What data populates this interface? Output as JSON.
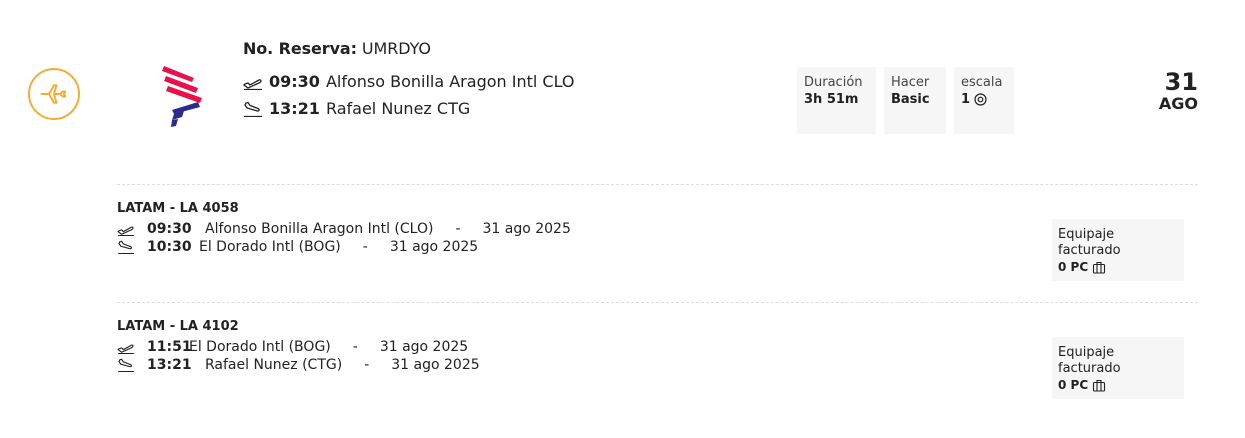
{
  "summary": {
    "booking_label": "No. Reserva:",
    "booking_code": "UMRDYO",
    "departure": {
      "time": "09:30",
      "airport": "Alfonso Bonilla Aragon Intl CLO"
    },
    "arrival": {
      "time": "13:21",
      "airport": "Rafael Nunez CTG"
    }
  },
  "info": {
    "duration_label": "Duración",
    "duration_value": "3h 51m",
    "fare_label": "Hacer",
    "fare_value": "Basic",
    "stops_label": "escala",
    "stops_value": "1"
  },
  "date": {
    "day": "31",
    "month": "AGO"
  },
  "segments": [
    {
      "title": "LATAM - LA 4058",
      "departure": {
        "time": "09:30",
        "airport": "Alfonso Bonilla Aragon Intl (CLO)",
        "sep": "-",
        "date": "31 ago 2025"
      },
      "arrival": {
        "time": "10:30",
        "airport": "El Dorado Intl (BOG)",
        "sep": "-",
        "date": "31 ago 2025"
      },
      "baggage_label": "Equipaje facturado",
      "baggage_value": "0 PC"
    },
    {
      "title": "LATAM - LA 4102",
      "departure": {
        "time": "11:51",
        "airport": "El Dorado Intl (BOG)",
        "sep": "-",
        "date": "31 ago 2025"
      },
      "arrival": {
        "time": "13:21",
        "airport": "Rafael Nunez (CTG)",
        "sep": "-",
        "date": "31 ago 2025"
      },
      "baggage_label": "Equipaje facturado",
      "baggage_value": "0 PC"
    }
  ],
  "icons": {
    "plane": "plane-icon",
    "takeoff": "takeoff-icon",
    "landing": "landing-icon",
    "stop": "stop-icon",
    "luggage": "luggage-icon",
    "airline_logo": "latam-logo"
  },
  "colors": {
    "accent": "#f2ad35",
    "logo_red": "#e8114b",
    "logo_blue": "#2d2a8c",
    "box_bg": "#f6f6f6"
  }
}
